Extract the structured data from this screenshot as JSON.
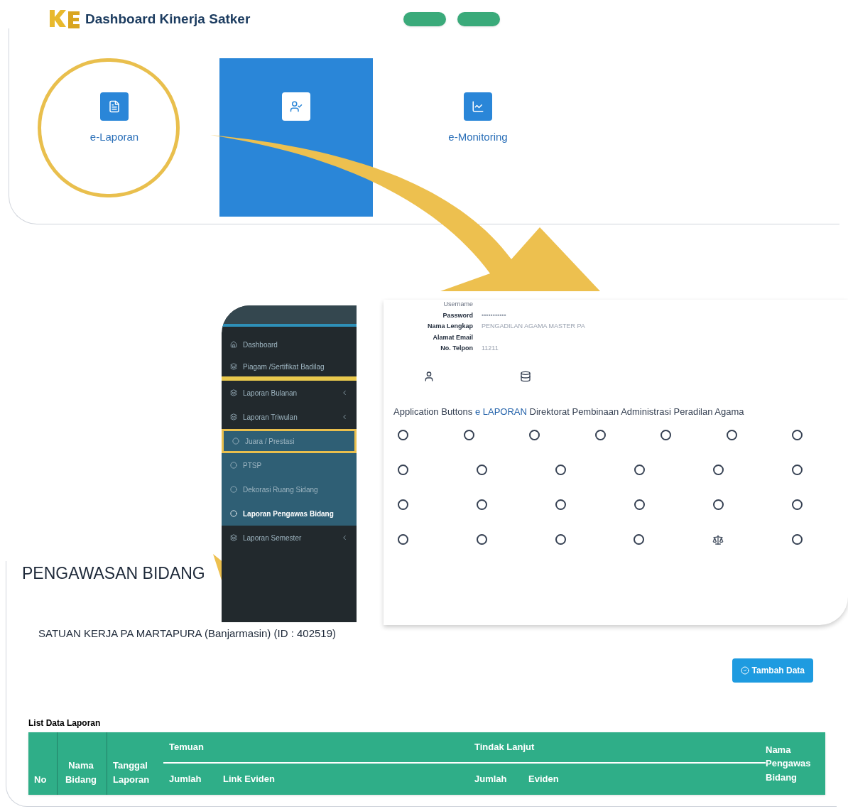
{
  "header": {
    "title": "Dashboard Kinerja Satker",
    "buttons": [
      {
        "kind": "green"
      },
      {
        "kind": "green"
      }
    ]
  },
  "feature_cards": [
    {
      "title": "e-Laporan",
      "selected": false,
      "circled": true
    },
    {
      "selected": true,
      "circled": false
    },
    {
      "title": "e-Monitoring",
      "selected": false,
      "circled": false
    }
  ],
  "sidebar": {
    "items": [
      {
        "label": "Dashboard",
        "kind": "home",
        "selected": false,
        "highlighted": false,
        "underlined": false
      },
      {
        "label": "Piagam /Sertifikat Badilag",
        "kind": "group",
        "selected": false,
        "highlighted": false,
        "underlined": true
      },
      {
        "label": "Laporan Bulanan",
        "kind": "group",
        "selected": false,
        "highlighted": false,
        "underlined": false
      },
      {
        "label": "Laporan Triwulan",
        "kind": "group",
        "selected": false,
        "highlighted": false,
        "underlined": false
      },
      {
        "label": "Juara / Prestasi",
        "kind": "sub",
        "selected": false,
        "highlighted": true,
        "underlined": false
      },
      {
        "label": "PTSP",
        "kind": "sub",
        "selected": false,
        "highlighted": false,
        "underlined": false
      },
      {
        "label": "Dekorasi Ruang Sidang",
        "kind": "sub",
        "selected": false,
        "highlighted": false,
        "underlined": false
      },
      {
        "label": "Laporan Pengawas Bidang",
        "kind": "sub",
        "selected": true,
        "highlighted": false,
        "underlined": false
      },
      {
        "label": "Laporan Semester",
        "kind": "group",
        "selected": false,
        "highlighted": false,
        "underlined": false
      }
    ]
  },
  "profile": {
    "fields": [
      {
        "label": "Username"
      },
      {
        "label": "Password",
        "value": "•••••••••••"
      },
      {
        "label": "Nama Lengkap",
        "value": "PENGADILAN AGAMA MASTER PA"
      },
      {
        "label": "Alamat Email"
      },
      {
        "label": "No. Telpon",
        "value": "11211"
      }
    ],
    "heading_parts": [
      {
        "text": "Application Buttons ",
        "kind": "plain"
      },
      {
        "text": "e LAPORAN",
        "kind": "link"
      },
      {
        "text": " Direktorat Pembinaan Administrasi Peradilan Agama",
        "kind": "plain"
      }
    ],
    "app_buttons": [
      [
        {
          "kind": "circle"
        },
        {
          "kind": "circle"
        },
        {
          "kind": "circle"
        },
        {
          "kind": "circle"
        },
        {
          "kind": "circle"
        },
        {
          "kind": "circle"
        },
        {
          "kind": "circle"
        }
      ],
      [
        {
          "kind": "circle"
        },
        {
          "kind": "circle"
        },
        {
          "kind": "circle"
        },
        {
          "kind": "circle"
        },
        {
          "kind": "circle"
        },
        {
          "kind": "circle"
        }
      ],
      [
        {
          "kind": "circle"
        },
        {
          "kind": "circle"
        },
        {
          "kind": "circle"
        },
        {
          "kind": "circle"
        },
        {
          "kind": "circle"
        },
        {
          "kind": "circle"
        }
      ],
      [
        {
          "kind": "circle"
        },
        {
          "kind": "circle"
        },
        {
          "kind": "circle"
        },
        {
          "kind": "circle"
        },
        {
          "kind": "scale"
        },
        {
          "kind": "circle"
        }
      ]
    ]
  },
  "report": {
    "title": "PENGAWASAN BIDANG",
    "subtitle": "SATUAN KERJA PA MARTAPURA (Banjarmasin) (ID : 402519)",
    "add_button": "Tambah Data",
    "list_title": "List Data Laporan",
    "columns": {
      "no": "No",
      "nama_bidang": "Nama Bidang",
      "tanggal": "Tanggal Laporan",
      "temuan": "Temuan",
      "temuan_jumlah": "Jumlah",
      "temuan_link": "Link Eviden",
      "tindak": "Tindak Lanjut",
      "tindak_jumlah": "Jumlah",
      "tindak_eviden": "Eviden",
      "pengawas": "Nama Pengawas Bidang"
    }
  }
}
